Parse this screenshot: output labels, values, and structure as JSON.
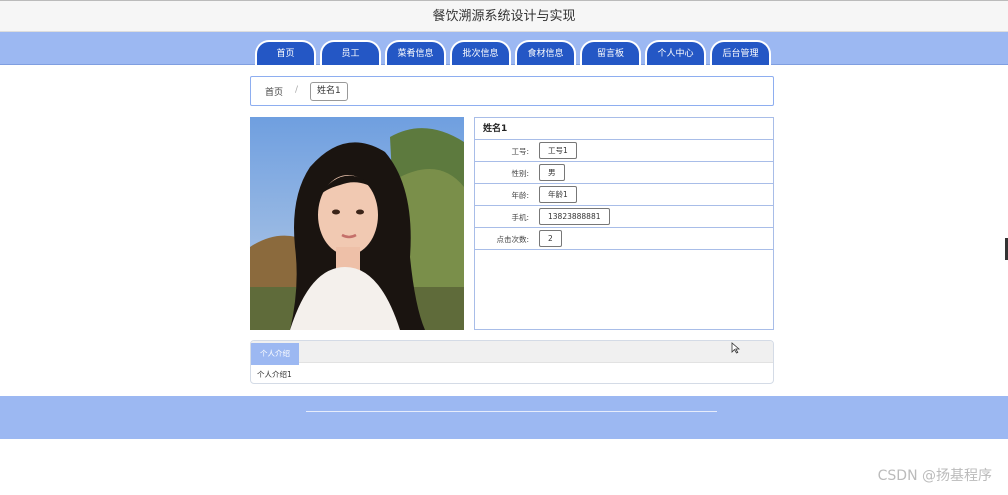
{
  "site": {
    "title": "餐饮溯源系统设计与实现"
  },
  "nav": {
    "items": [
      "首页",
      "员工",
      "菜肴信息",
      "批次信息",
      "食材信息",
      "留言板",
      "个人中心",
      "后台管理"
    ]
  },
  "breadcrumb": {
    "home": "首页",
    "separator": "/",
    "current": "姓名1"
  },
  "detail": {
    "name": "姓名1",
    "fields": [
      {
        "label": "工号:",
        "value": "工号1"
      },
      {
        "label": "性别:",
        "value": "男"
      },
      {
        "label": "年龄:",
        "value": "年龄1"
      },
      {
        "label": "手机:",
        "value": "13823888881"
      },
      {
        "label": "点击次数:",
        "value": "2"
      }
    ]
  },
  "intro": {
    "tab": "个人介绍",
    "text": "个人介绍1"
  },
  "watermark": "CSDN @扬基程序",
  "colors": {
    "nav_bg": "#9cb8f2",
    "nav_item": "#2457c5",
    "border": "#8eaef0"
  }
}
